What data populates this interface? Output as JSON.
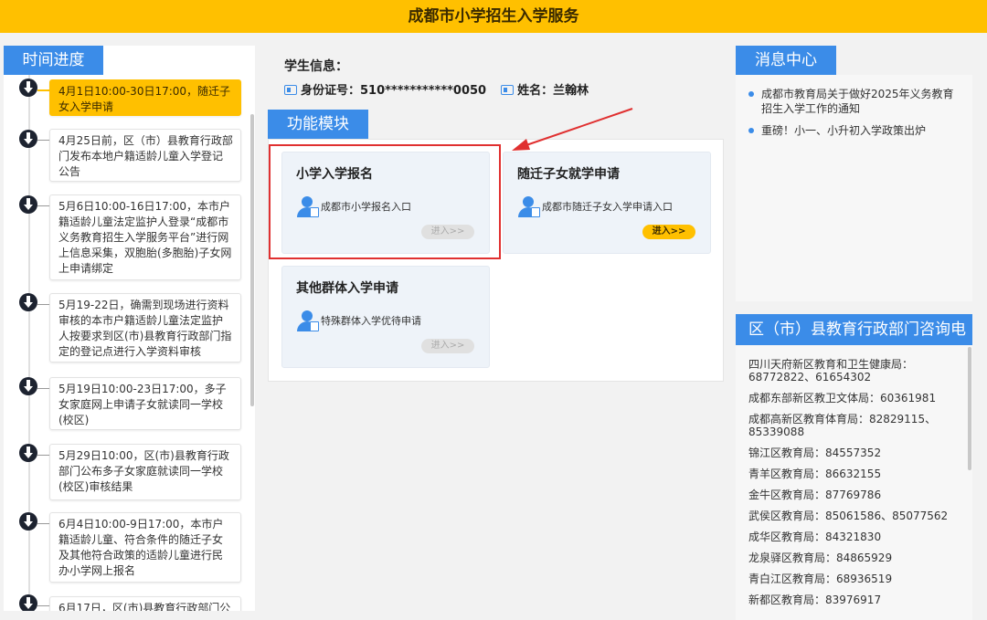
{
  "header": {
    "title": "成都市小学招生入学服务"
  },
  "timeline": {
    "tab_label": "时间进度",
    "items": [
      "4月1日10:00-30日17:00，随迁子女入学申请",
      "4月25日前，区（市）县教育行政部门发布本地户籍适龄儿童入学登记公告",
      "5月6日10:00-16日17:00，本市户籍适龄儿童法定监护人登录“成都市义务教育招生入学服务平台”进行网上信息采集，双胞胎(多胞胎)子女网上申请绑定",
      "5月19-22日，确需到现场进行资料审核的本市户籍适龄儿童法定监护人按要求到区(市)县教育行政部门指定的登记点进行入学资料审核",
      "5月19日10:00-23日17:00，多子女家庭网上申请子女就读同一学校(校区)",
      "5月29日10:00，区(市)县教育行政部门公布多子女家庭就读同一学校(校区)审核结果",
      "6月4日10:00-9日17:00，本市户籍适龄儿童、符合条件的随迁子女及其他符合政策的适龄儿童进行民办小学网上报名",
      "6月17日，区(市)县教育行政部门公"
    ]
  },
  "student": {
    "title": "学生信息：",
    "id_label": "身份证号：510***********0050",
    "name_label": "姓名：兰翰林"
  },
  "modules": {
    "tab_label": "功能模块",
    "cards": [
      {
        "title": "小学入学报名",
        "link": "成都市小学报名入口",
        "button": "进入>>"
      },
      {
        "title": "随迁子女就学申请",
        "link": "成都市随迁子女入学申请入口",
        "button": "进入>>"
      },
      {
        "title": "其他群体入学申请",
        "link": "特殊群体入学优待申请",
        "button": "进入>>"
      }
    ]
  },
  "messages": {
    "tab_label": "消息中心",
    "items": [
      "成都市教育局关于做好2025年义务教育招生入学工作的通知",
      "重磅！小一、小升初入学政策出炉"
    ]
  },
  "phones": {
    "tab_label": "区（市）县教育行政部门咨询电话",
    "items": [
      "四川天府新区教育和卫生健康局：68772822、61654302",
      "成都东部新区教卫文体局：60361981",
      "成都高新区教育体育局：82829115、85339088",
      "锦江区教育局：84557352",
      "青羊区教育局：86632155",
      "金牛区教育局：87769786",
      "武侯区教育局：85061586、85077562",
      "成华区教育局：84321830",
      "龙泉驿区教育局：84865929",
      "青白江区教育局：68936519",
      "新都区教育局：83976917"
    ]
  },
  "colors": {
    "accent_yellow": "#ffc000",
    "accent_blue": "#3b8ce8",
    "highlight_red": "#e03030"
  }
}
